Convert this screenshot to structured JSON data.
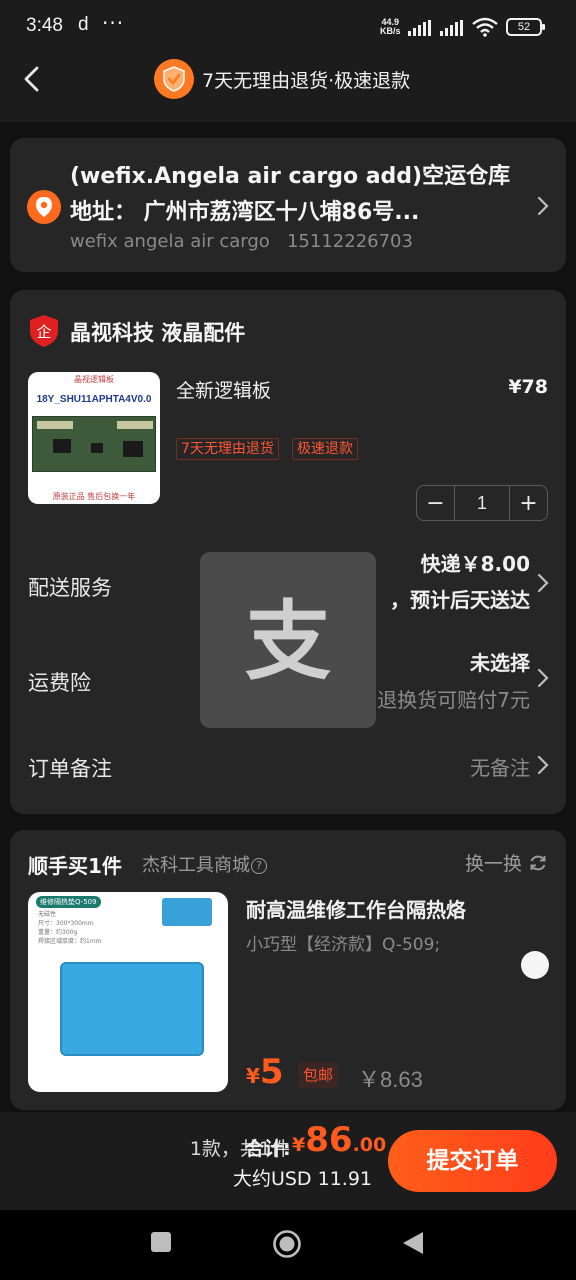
{
  "status_bar": {
    "time": "3:48",
    "app_letter": "d",
    "more": "···",
    "speed_value": "44.9",
    "speed_unit": "KB/s",
    "battery": "52"
  },
  "header": {
    "title": "7天无理由退货·极速退款",
    "back_icon": "chevron-left-icon",
    "badge_icon": "shield-check-icon",
    "badge_color": "#ff7a22"
  },
  "address": {
    "line1": "(wefix.Angela air cargo add)空运仓库",
    "line2": "地址： 广州市荔湾区十八埔86号...",
    "contact_name": "wefix angela air cargo",
    "contact_phone": "15112226703"
  },
  "store": {
    "name": "晶视科技 液晶配件",
    "icon": "enterprise-badge-icon"
  },
  "product": {
    "image_top_text": "晶视逻辑板",
    "image_code": "18Y_SHU11APHTA4V0.0",
    "image_bottom_text": "原装正品     售后包换一年",
    "title": "全新逻辑板",
    "price": "¥78",
    "tags": [
      "7天无理由退货",
      "极速退款"
    ],
    "quantity": "1",
    "minus": "−",
    "plus": "+"
  },
  "rows": {
    "delivery_label": "配送服务",
    "delivery_value": "快递￥8.00",
    "delivery_sub": "，预计后天送达",
    "insurance_label": "运费险",
    "insurance_value": "未选择",
    "insurance_sub": "退换货可赔付7元",
    "note_label": "订单备注",
    "note_value": "无备注"
  },
  "overlay": {
    "icon": "alipay-icon",
    "glyph": "支"
  },
  "addon": {
    "title": "顺手买1件",
    "store": "杰科工具商城",
    "help": "?",
    "swap_label": "换一换",
    "image_label": "维修隔热垫Q-509",
    "image_spec": "无磁性\n尺寸：300*300mm\n重量：约300g\n焊接区域厚度：约1mm",
    "name": "耐高温维修工作台隔热烙",
    "variant": "小巧型【经济款】Q-509;",
    "price_symbol": "¥",
    "price": "5",
    "free_shipping": "包邮",
    "original_price": "￥8.63"
  },
  "bottom": {
    "count": "1款，共1件",
    "total_label": "合计:",
    "total_symbol": "¥",
    "total_int": "86",
    "total_dec": ".00",
    "usd": "大约USD 11.91",
    "submit": "提交订单"
  },
  "colors": {
    "accent": "#ff5a1f",
    "background": "#111111",
    "card": "#262626"
  }
}
